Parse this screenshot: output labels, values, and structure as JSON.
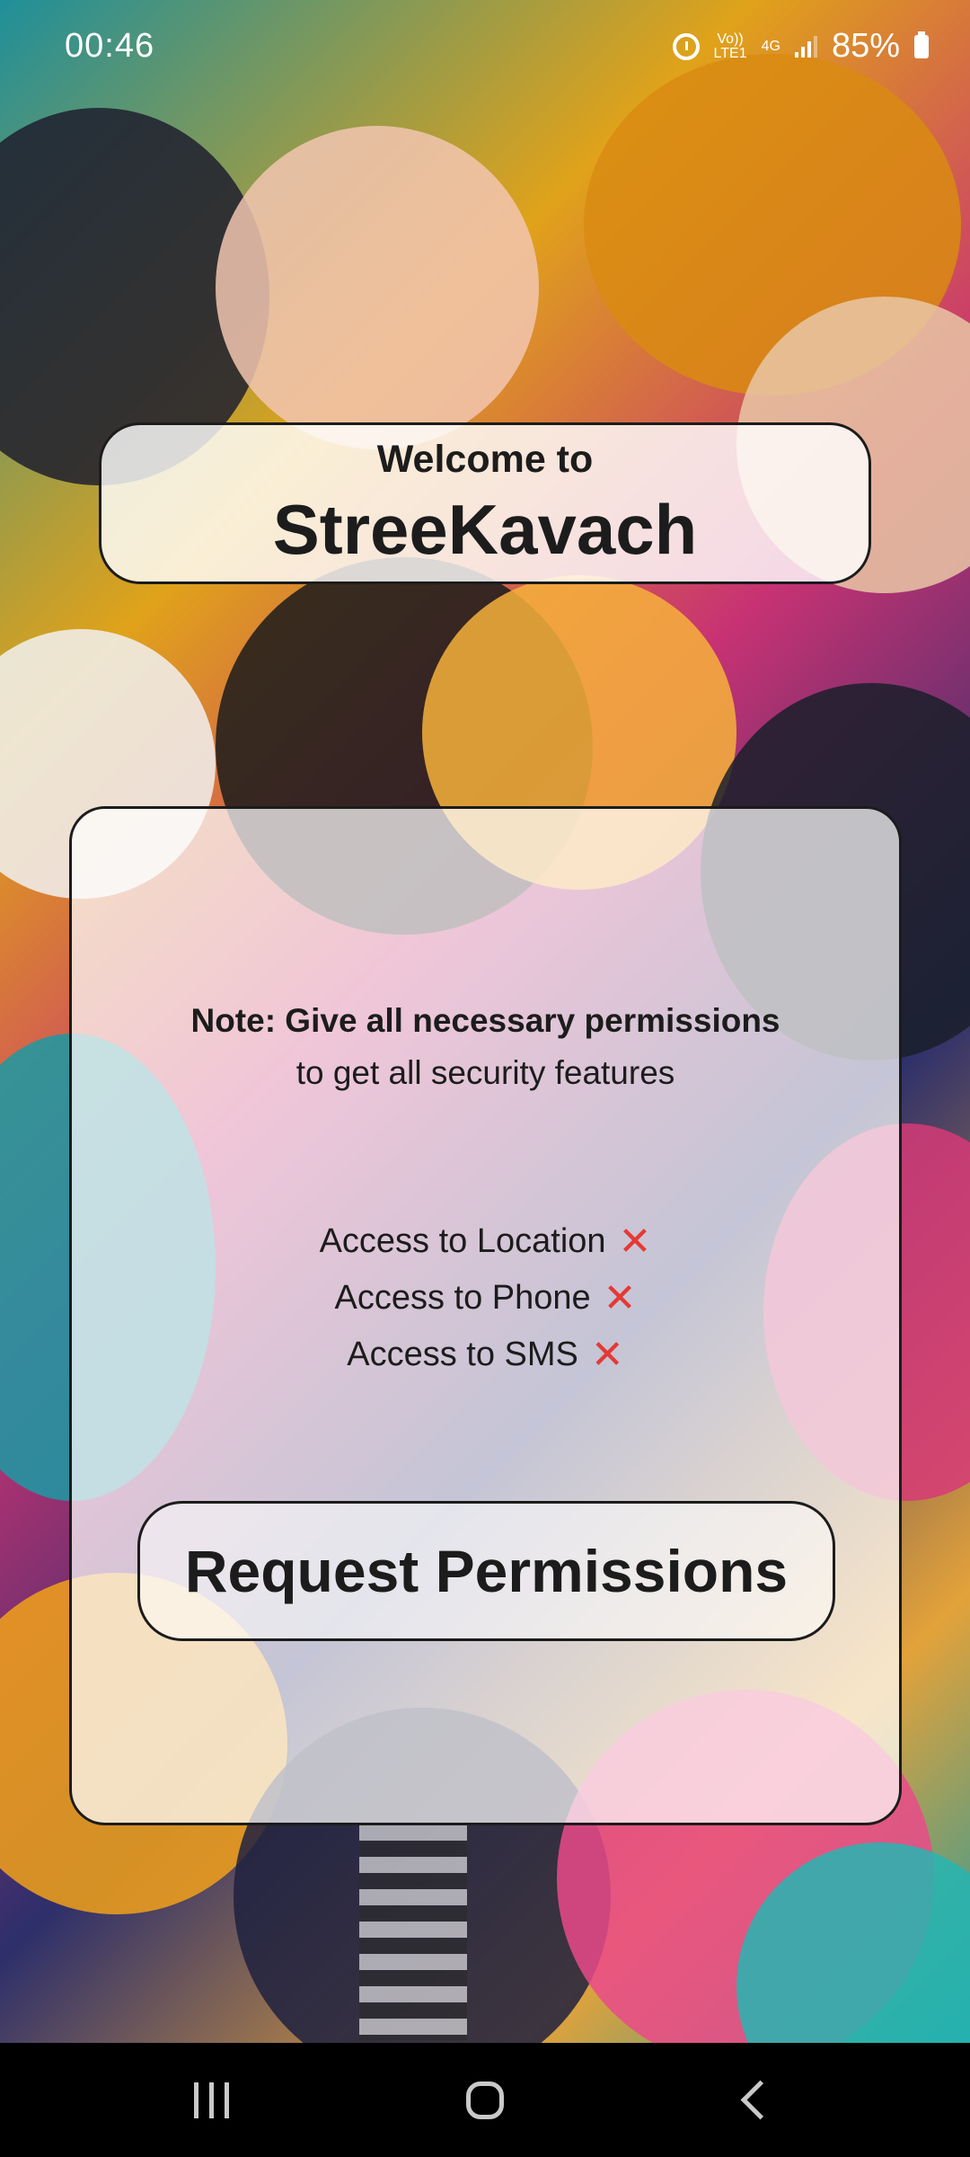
{
  "status_bar": {
    "time": "00:46",
    "network_top": "Vo))",
    "network_bottom": "LTE1",
    "network_type": "4G",
    "battery": "85%",
    "icons": [
      "alarm-icon",
      "signal-icon",
      "battery-icon"
    ]
  },
  "welcome": {
    "line": "Welcome to",
    "app_name": "StreeKavach"
  },
  "note": {
    "bold": "Note: Give all necessary permissions",
    "normal": "to get all security features"
  },
  "permissions": [
    {
      "label": "Access to Location",
      "status_icon": "x-icon",
      "status": "✕"
    },
    {
      "label": "Access to Phone",
      "status_icon": "x-icon",
      "status": "✕"
    },
    {
      "label": "Access to SMS",
      "status_icon": "x-icon",
      "status": "✕"
    }
  ],
  "request_button": {
    "label": "Request Permissions"
  },
  "nav_bar": {
    "buttons": [
      "recents-icon",
      "home-icon",
      "back-icon"
    ]
  },
  "colors": {
    "text": "#1c1c1c",
    "denied": "#e53935",
    "nav_background": "#000000"
  }
}
